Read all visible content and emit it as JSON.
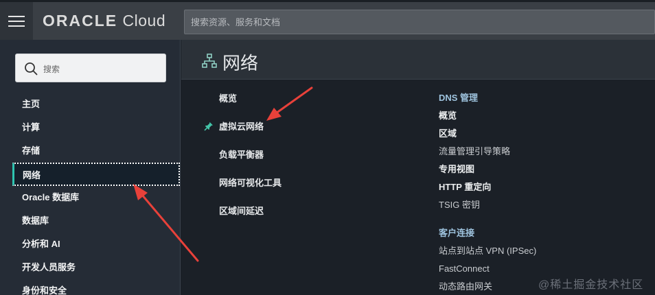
{
  "topbar": {
    "logo_brand": "ORACLE",
    "logo_product": "Cloud",
    "search_placeholder": "搜索资源、服务和文档"
  },
  "sidebar": {
    "search_placeholder": "搜索",
    "items": [
      {
        "label": "主页",
        "active": false
      },
      {
        "label": "计算",
        "active": false
      },
      {
        "label": "存储",
        "active": false
      },
      {
        "label": "网络",
        "active": true
      },
      {
        "label": "Oracle 数据库",
        "active": false
      },
      {
        "label": "数据库",
        "active": false
      },
      {
        "label": "分析和 AI",
        "active": false
      },
      {
        "label": "开发人员服务",
        "active": false
      },
      {
        "label": "身份和安全",
        "active": false
      }
    ]
  },
  "main": {
    "title": "网络",
    "links": [
      {
        "label": "概览",
        "pinned": false
      },
      {
        "label": "虚拟云网络",
        "pinned": true
      },
      {
        "label": "负载平衡器",
        "pinned": false
      },
      {
        "label": "网络可视化工具",
        "pinned": false
      },
      {
        "label": "区域间延迟",
        "pinned": false
      }
    ],
    "dns": {
      "header": "DNS 管理",
      "items": [
        "概览",
        "区域",
        "流量管理引导策略",
        "专用视图",
        "HTTP 重定向",
        "TSIG 密钥"
      ]
    },
    "customer": {
      "header": "客户连接",
      "items": [
        "站点到站点 VPN (IPSec)",
        "FastConnect",
        "动态路由网关"
      ]
    }
  },
  "watermark": "@稀土掘金技术社区",
  "colors": {
    "accent_teal": "#2ec4b0",
    "arrow_red": "#e8413a",
    "section_header": "#9fc4df"
  },
  "icons": {
    "menu": "hamburger-icon",
    "search": "search-icon",
    "network": "network-icon",
    "pin": "pin-icon"
  }
}
